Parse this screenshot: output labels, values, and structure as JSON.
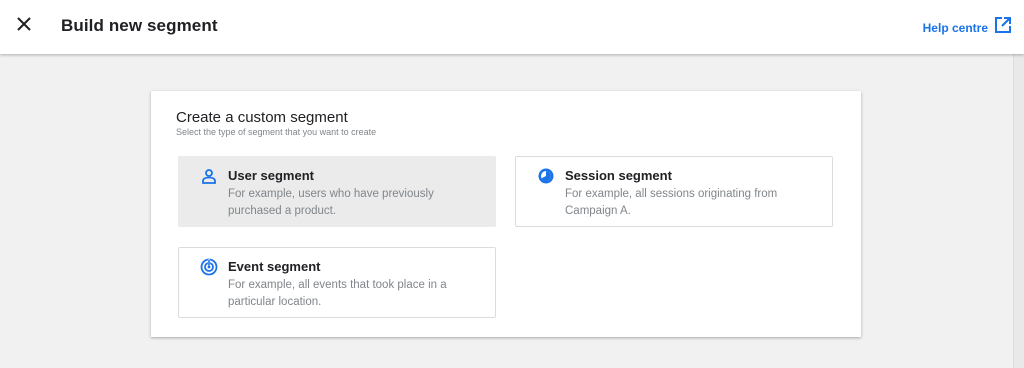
{
  "header": {
    "title": "Build new segment",
    "help_label": "Help centre",
    "close_icon": "close-icon",
    "help_icon": "open-in-new-icon"
  },
  "colors": {
    "accent": "#1a73e8",
    "selected_bg": "#ebebeb",
    "page_bg": "#f1f1f1"
  },
  "card": {
    "title": "Create a custom segment",
    "subtitle": "Select the type of segment that you want to create",
    "options": [
      {
        "icon": "person-icon",
        "title": "User segment",
        "description": "For example, users who have previously purchased a product.",
        "selected": true
      },
      {
        "icon": "session-icon",
        "title": "Session segment",
        "description": "For example, all sessions originating from Campaign A.",
        "selected": false
      },
      {
        "icon": "event-icon",
        "title": "Event segment",
        "description": "For example, all events that took place in a particular location.",
        "selected": false
      }
    ]
  }
}
